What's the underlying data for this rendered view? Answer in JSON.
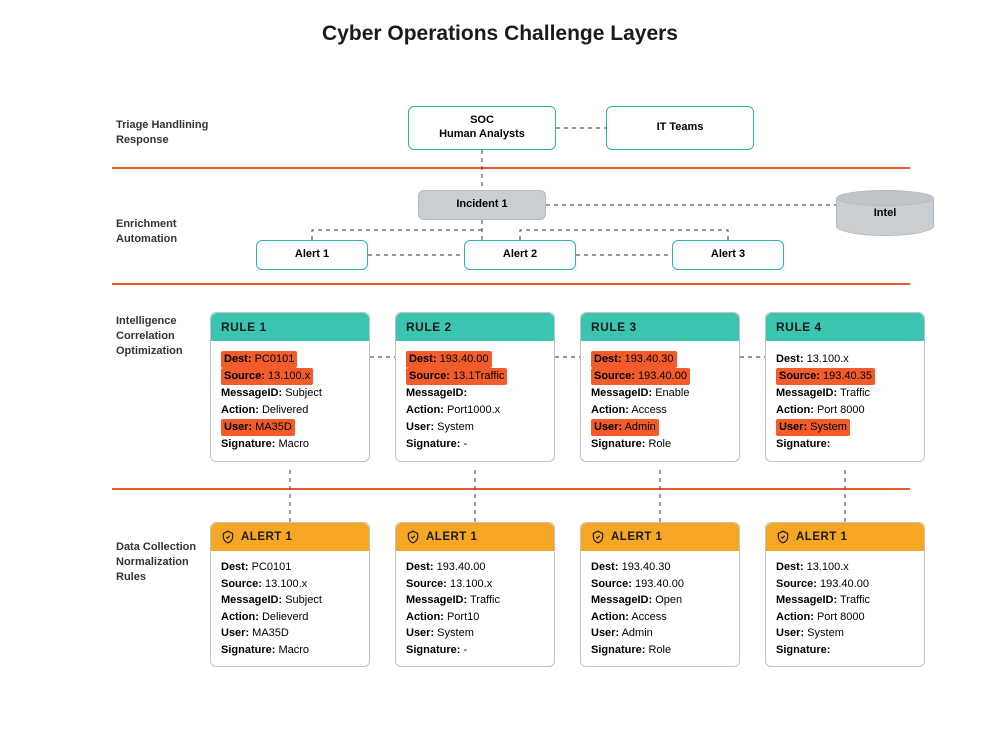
{
  "title": "Cyber Operations Challenge Layers",
  "labels": {
    "triage": "Triage Handlining\nResponse",
    "enrichment": "Enrichment\nAutomation",
    "intelligence": "Intelligence\nCorrelation\nOptimization",
    "datacollection": "Data Collection\nNormalization\nRules"
  },
  "top": {
    "soc": "SOC\nHuman Analysts",
    "it": "IT Teams"
  },
  "enrich": {
    "incident": "Incident 1",
    "intel": "Intel",
    "alert1": "Alert 1",
    "alert2": "Alert 2",
    "alert3": "Alert 3"
  },
  "rules": [
    {
      "title": "RULE 1",
      "dest": "PC0101",
      "source": "13.100.x",
      "msg": "Subject",
      "action": "Delivered",
      "user": "MA35D",
      "sig": "Macro",
      "hlDest": true,
      "hlSrc": true,
      "hlUser": true
    },
    {
      "title": "RULE 2",
      "dest": "193.40.00",
      "source": "13.1Traffic",
      "msg": "",
      "action": "Port1000.x",
      "user": "System",
      "sig": "-",
      "hlDest": true,
      "hlSrc": true,
      "hlUser": false
    },
    {
      "title": "RULE 3",
      "dest": "193.40.30",
      "source": "193.40.00",
      "msg": "Enable",
      "action": "Access",
      "user": "Admin",
      "sig": "Role",
      "hlDest": true,
      "hlSrc": true,
      "hlUser": true
    },
    {
      "title": "RULE 4",
      "dest": "13.100.x",
      "source": "193.40.35",
      "msg": "Traffic",
      "action": "Port 8000",
      "user": "System",
      "sig": "",
      "hlDest": false,
      "hlSrc": true,
      "hlUser": true
    }
  ],
  "alerts": [
    {
      "title": "ALERT 1",
      "dest": "PC0101",
      "source": "13.100.x",
      "msg": "Subject",
      "action": "Delieverd",
      "user": "MA35D",
      "sig": "Macro"
    },
    {
      "title": "ALERT 1",
      "dest": "193.40.00",
      "source": "13.100.x",
      "msg": "Traffic",
      "action": "Port10",
      "user": "System",
      "sig": "-"
    },
    {
      "title": "ALERT 1",
      "dest": "193.40.30",
      "source": "193.40.00",
      "msg": "Open",
      "action": "Access",
      "user": "Admin",
      "sig": "Role"
    },
    {
      "title": "ALERT 1",
      "dest": "13.100.x",
      "source": "193.40.00",
      "msg": "Traffic",
      "action": "Port 8000",
      "user": "System",
      "sig": ""
    }
  ],
  "field_labels": {
    "dest": "Dest:",
    "source": "Source:",
    "msg": "MessageID:",
    "action": "Action:",
    "user": "User:",
    "sig": "Signature:"
  }
}
